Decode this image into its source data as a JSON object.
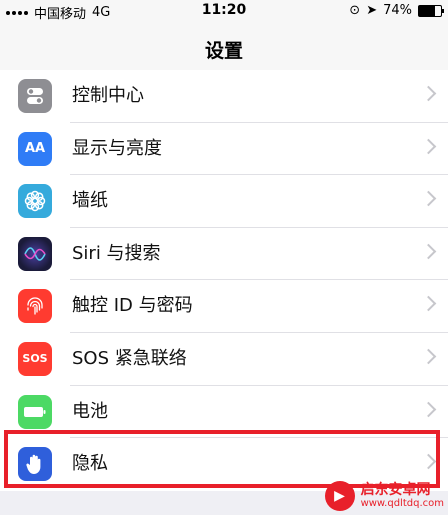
{
  "status_bar": {
    "carrier": "中国移动",
    "network": "4G",
    "time": "11:20",
    "battery": "74%",
    "battery_level": 0.74
  },
  "nav": {
    "title": "设置"
  },
  "rows": [
    {
      "label": "控制中心",
      "icon": "control-center-icon",
      "color": "#8e8e93"
    },
    {
      "label": "显示与亮度",
      "icon": "display-brightness-icon",
      "color": "#2f7cf6"
    },
    {
      "label": "墙纸",
      "icon": "wallpaper-icon",
      "color": "#35aadc"
    },
    {
      "label": "Siri 与搜索",
      "icon": "siri-icon",
      "color": "#1b1b3a"
    },
    {
      "label": "触控 ID 与密码",
      "icon": "touch-id-icon",
      "color": "#ff3b30"
    },
    {
      "label": "SOS 紧急联络",
      "icon": "sos-icon",
      "color": "#ff3b30",
      "icon_text": "SOS"
    },
    {
      "label": "电池",
      "icon": "battery-icon",
      "color": "#4cd964"
    },
    {
      "label": "隐私",
      "icon": "privacy-hand-icon",
      "color": "#2f5fdb"
    }
  ],
  "icons": {
    "display_glyph": "AA"
  },
  "watermark": {
    "line1": "启东安卓网",
    "line2": "www.qdltdq.com",
    "color": "#e8202a"
  }
}
